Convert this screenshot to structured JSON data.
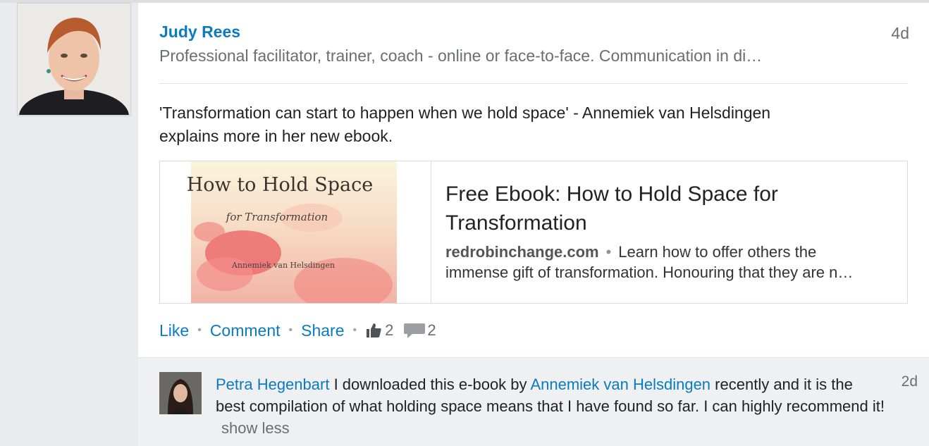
{
  "post": {
    "author": "Judy Rees",
    "headline": "Professional facilitator, trainer, coach - online or face-to-face. Communication in di…",
    "time": "4d",
    "text_line1": "'Transformation can start to happen when we hold space' - Annemiek van Helsdingen",
    "text_line2": "explains more in her new ebook."
  },
  "link": {
    "thumb_title": "How to Hold Space",
    "thumb_subtitle": "for Transformation",
    "thumb_author": "Annemiek van Helsdingen",
    "title": "Free Ebook: How to Hold Space for Transformation",
    "domain": "redrobinchange.com",
    "separator": "•",
    "desc_line1": "Learn how to offer others the",
    "desc_line2": "immense gift of transformation. Honouring that they are n…"
  },
  "actions": {
    "like": "Like",
    "comment": "Comment",
    "share": "Share",
    "bullet": "•",
    "like_count": "2",
    "comment_count": "2"
  },
  "comment": {
    "author": "Petra Hegenbart",
    "text_a": "I downloaded this e-book by",
    "mention": "Annemiek van Helsdingen",
    "text_b": "recently and it is the best compilation of what holding space means that I have found so far. I can highly recommend it!",
    "show_less": "show less",
    "time": "2d"
  },
  "colors": {
    "link_blue": "#0b7bc1",
    "meta_gray": "#6b6e71",
    "comment_bg": "#eff0f2",
    "page_bg": "#e9ebee"
  },
  "icons": [
    "like-thumb-icon",
    "comment-bubble-icon"
  ]
}
